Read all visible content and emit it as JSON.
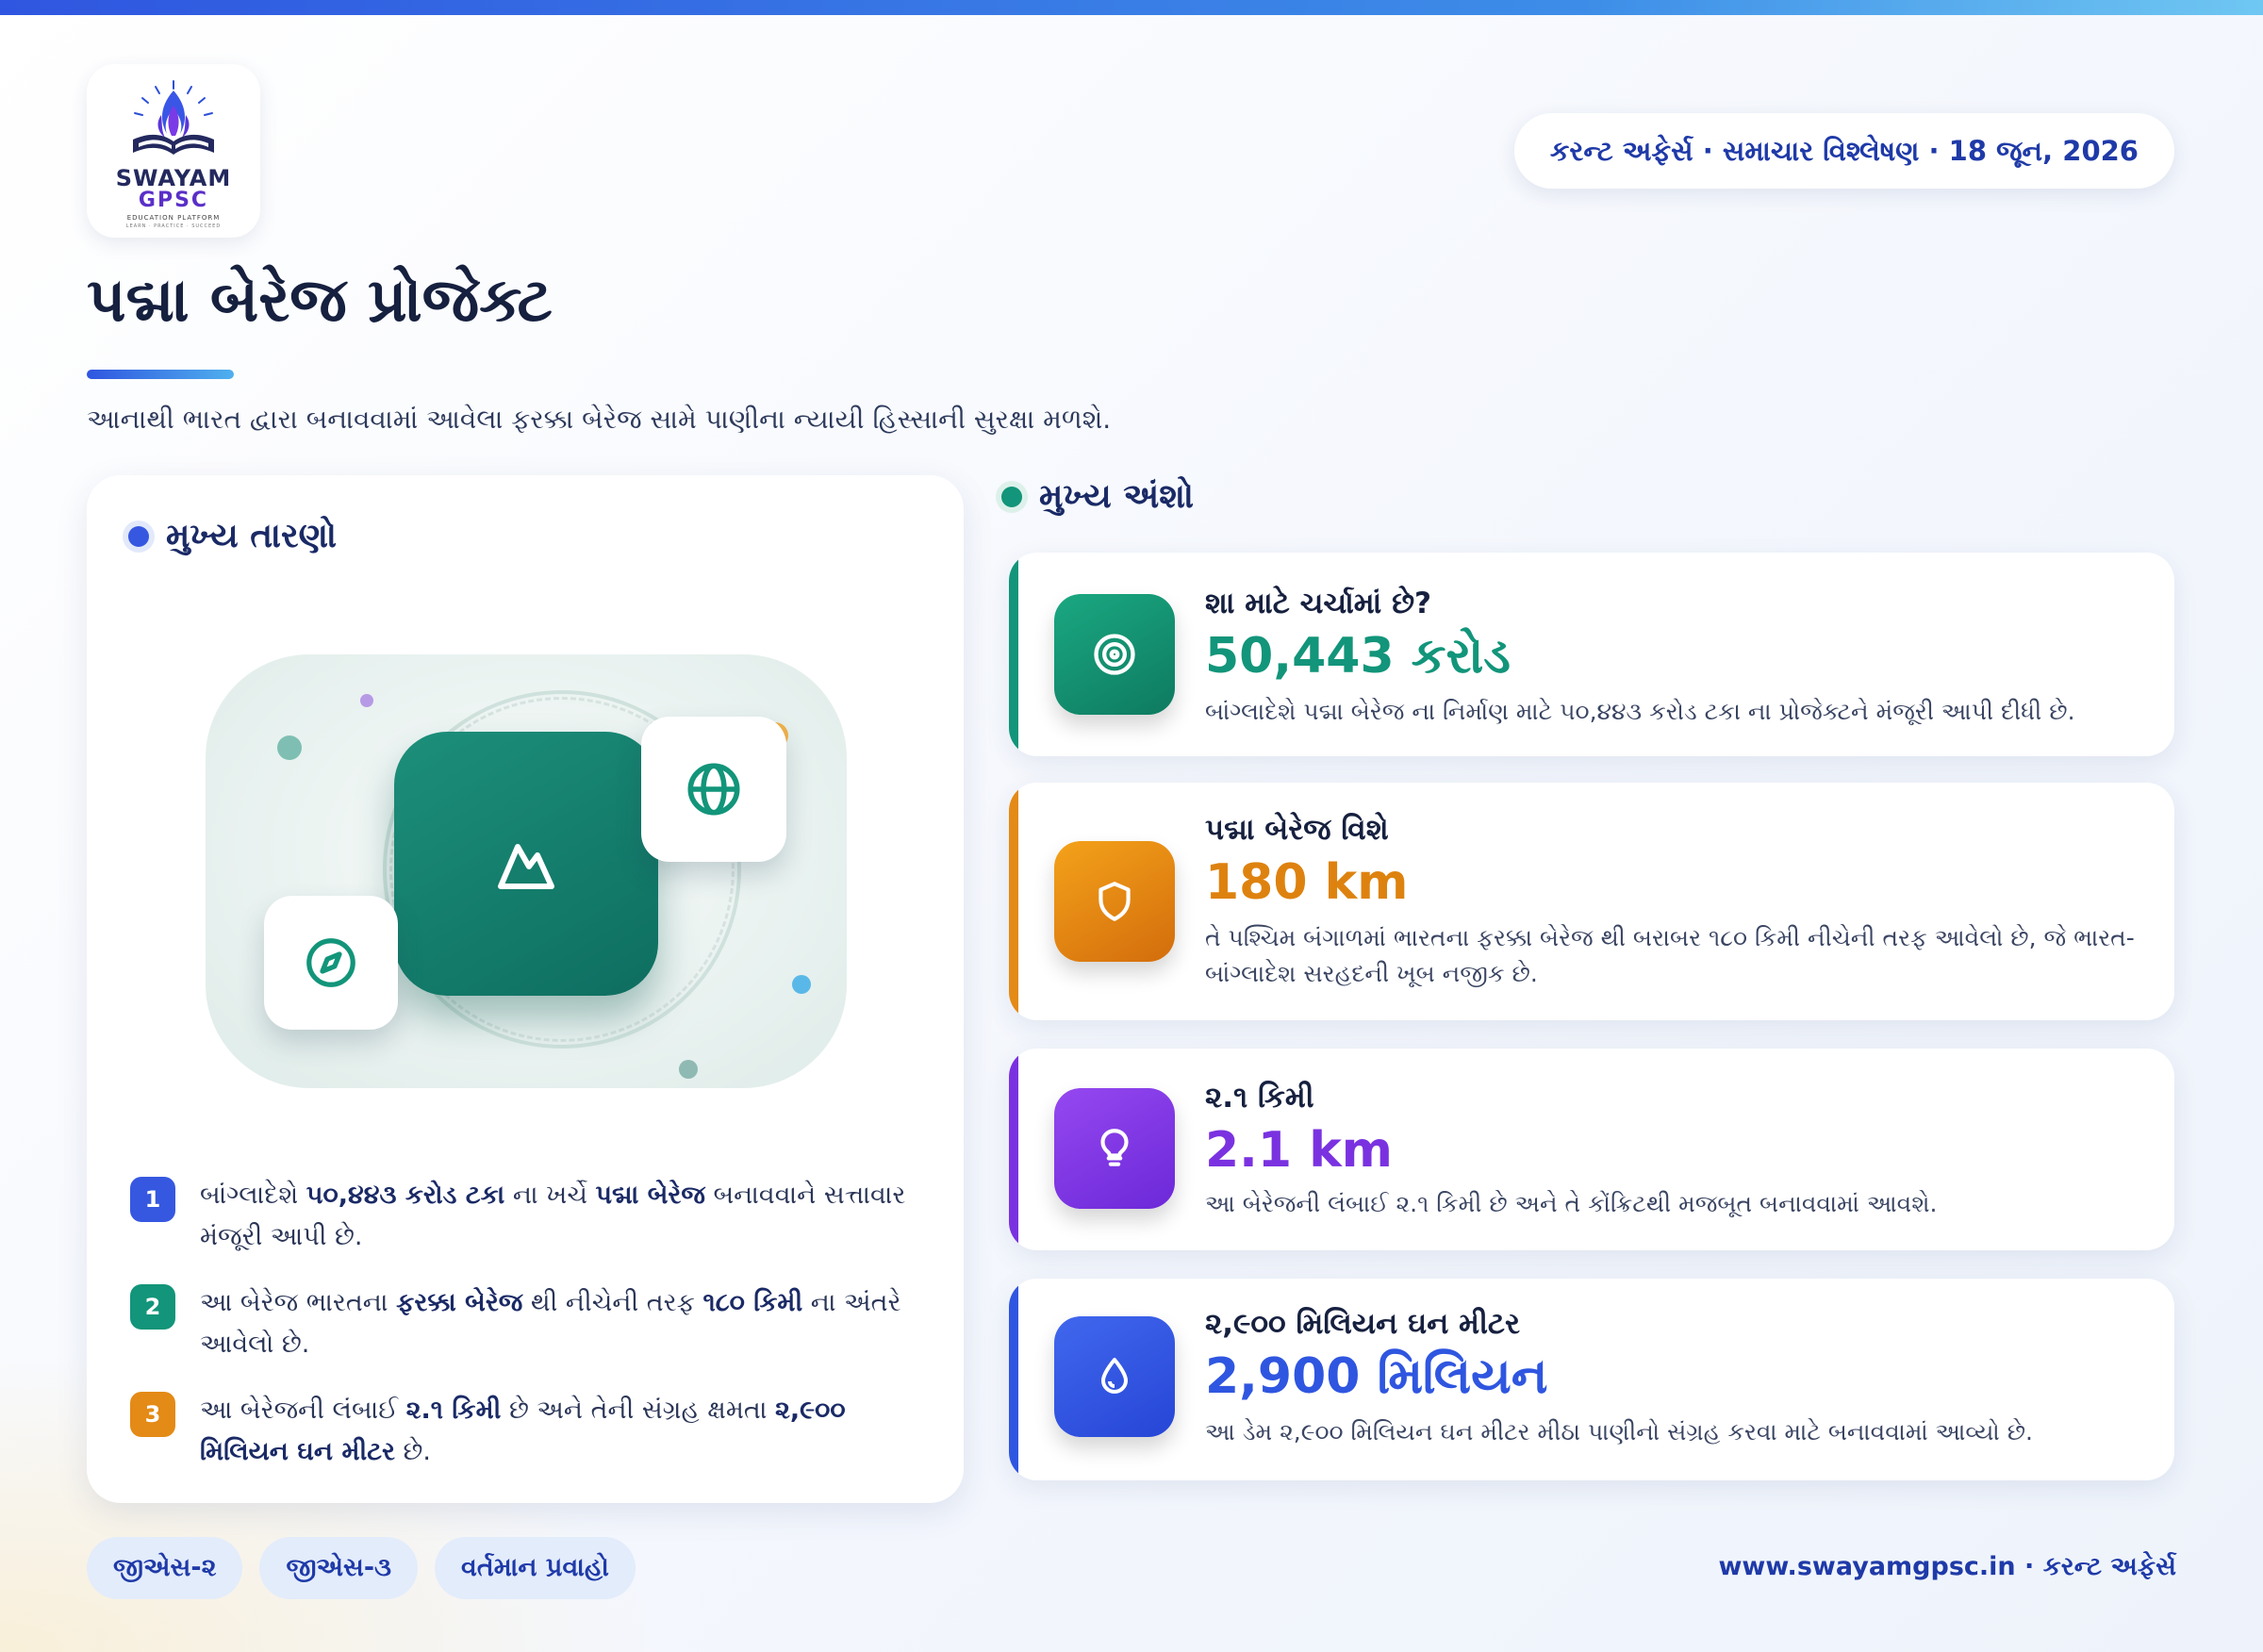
{
  "brand": {
    "name_line1": "SWAYAM",
    "name_line2": "GPSC",
    "subtitle": "EDUCATION PLATFORM",
    "tagline": "LEARN · PRACTICE · SUCCEED"
  },
  "header": {
    "date_pill": "કરન્ટ અફેર્સ · સમાચાર વિશ્લેષણ · 18 જૂન, 2026",
    "title": "પદ્મા બેરેજ પ્રોજેક્ટ",
    "subtitle": "આનાથી ભારત દ્વારા બનાવવામાં આવેલા ફરક્કા બેરેજ સામે પાણીના ન્યાયી હિસ્સાની સુરક્ષા મળશે."
  },
  "findings": {
    "heading": "મુખ્ય તારણો",
    "items": [
      {
        "num": "1",
        "color": "#3658e0",
        "parts": [
          {
            "t": "બાંગ્લાદેશે "
          },
          {
            "b": "૫૦,૪૪૩ કરોડ ટકા"
          },
          {
            "t": " ના ખર્ચે "
          },
          {
            "b": "પદ્મા બેરેજ"
          },
          {
            "t": " બનાવવાને સત્તાવાર મંજૂરી આપી છે."
          }
        ]
      },
      {
        "num": "2",
        "color": "#12957a",
        "parts": [
          {
            "t": "આ બેરેજ ભારતના "
          },
          {
            "b": "ફરક્કા બેરેજ"
          },
          {
            "t": " થી નીચેની તરફ "
          },
          {
            "b": "૧૮૦ કિમી"
          },
          {
            "t": " ના અંતરે આવેલો છે."
          }
        ]
      },
      {
        "num": "3",
        "color": "#e48a16",
        "parts": [
          {
            "t": "આ બેરેજની લંબાઈ "
          },
          {
            "b": "૨.૧ કિમી"
          },
          {
            "t": " છે અને તેની સંગ્રહ ક્ષમતા "
          },
          {
            "b": "૨,૯૦૦ મિલિયન ઘન મીટર"
          },
          {
            "t": " છે."
          }
        ]
      }
    ]
  },
  "highlights": {
    "heading": "મુખ્ય અંશો",
    "cards": [
      {
        "label": "શા માટે ચર્ચામાં છે?",
        "value": "50,443 કરોડ",
        "value_color": "#12957a",
        "desc": "બાંગ્લાદેશે પદ્મા બેરેજ ના નિર્માણ માટે ૫૦,૪૪૩ કરોડ ટકા ના પ્રોજેક્ટને મંજૂરી આપી દીધી છે.",
        "icon": "target-icon",
        "grad": [
          "#1aa881",
          "#0e7a60"
        ],
        "accent": "#12957a"
      },
      {
        "label": "પદ્મા બેરેજ વિશે",
        "value": "180 km",
        "value_color": "#de820f",
        "desc": "તે પશ્ચિમ બંગાળમાં ભારતના ફરક્કા બેરેજ થી બરાબર ૧૮૦ કિમી નીચેની તરફ આવેલો છે, જે ભારત-બાંગ્લાદેશ સરહદની ખૂબ નજીક છે.",
        "icon": "shield-icon",
        "grad": [
          "#f4a21a",
          "#d36d0c"
        ],
        "accent": "#e48a16"
      },
      {
        "label": "૨.૧ કિમી",
        "value": "2.1 km",
        "value_color": "#7a32e0",
        "desc": "આ બેરેજની લંબાઈ ૨.૧ કિમી છે અને તે કોંક્રિટથી મજબૂત બનાવવામાં આવશે.",
        "icon": "lightbulb-icon",
        "grad": [
          "#9548f0",
          "#6c28d8"
        ],
        "accent": "#7a32e0"
      },
      {
        "label": "૨,૯૦૦ મિલિયન ઘન મીટર",
        "value": "2,900 મિલિયન",
        "value_color": "#2f56e0",
        "desc": "આ ડેમ ૨,૯૦૦ મિલિયન ઘન મીટર મીઠા પાણીનો સંગ્રહ કરવા માટે બનાવવામાં આવ્યો છે.",
        "icon": "water-drop-icon",
        "grad": [
          "#4167ee",
          "#2646d6"
        ],
        "accent": "#2f56e0"
      }
    ]
  },
  "tags": [
    "જીએસ-૨",
    "જીએસ-૩",
    "વર્તમાન પ્રવાહો"
  ],
  "footer": "www.swayamgpsc.in · કરન્ટ અફેર્સ",
  "colors": {
    "primary": "#1f3aa8",
    "teal": "#12957a",
    "orange": "#e48a16",
    "purple": "#7a32e0"
  }
}
